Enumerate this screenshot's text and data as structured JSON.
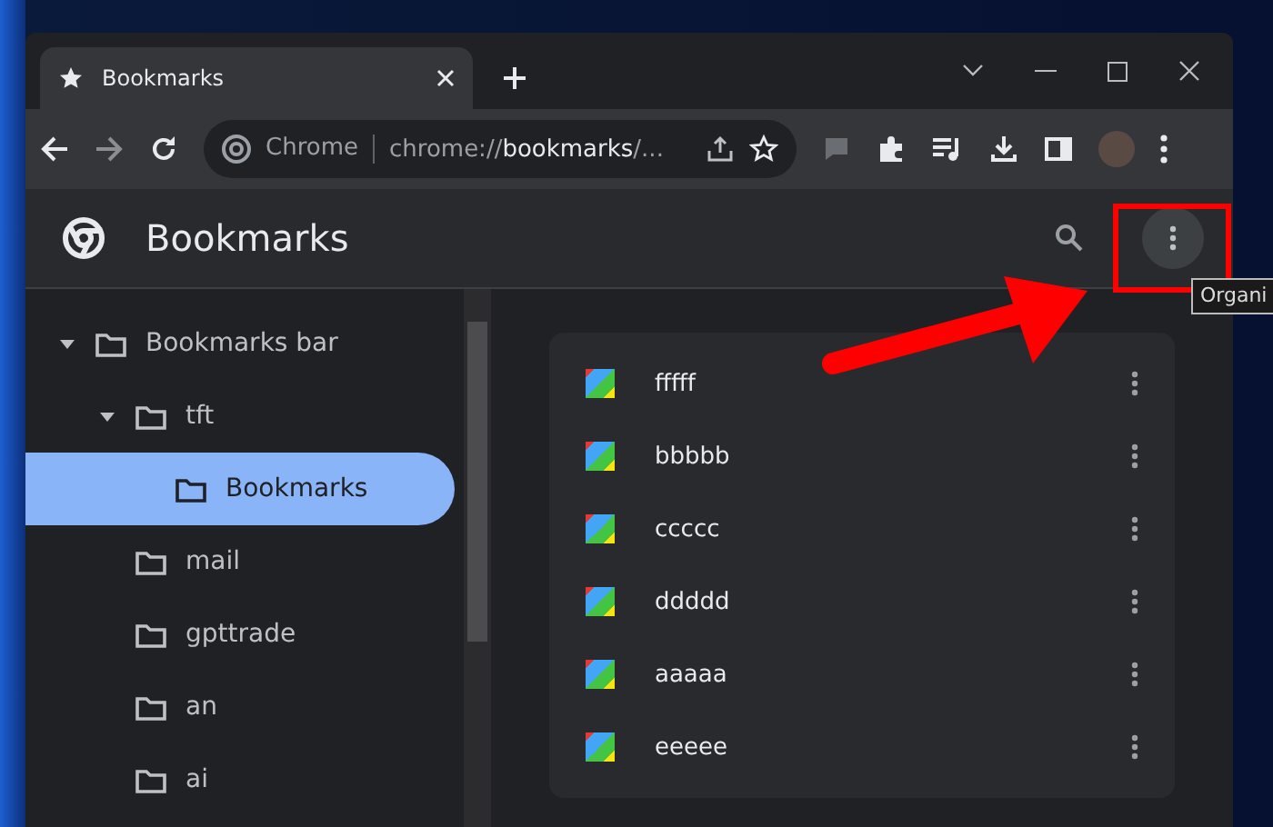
{
  "tab": {
    "title": "Bookmarks",
    "selected": true
  },
  "address_bar": {
    "site_label": "Chrome",
    "url": "chrome://**bookmarks**/..."
  },
  "page": {
    "title": "Bookmarks"
  },
  "tree": [
    {
      "label": "Bookmarks bar",
      "selected": false,
      "expanded": true,
      "children": [
        {
          "label": "tft",
          "selected": false,
          "expanded": true,
          "children": [
            {
              "label": "Bookmarks",
              "selected": true
            }
          ]
        },
        {
          "label": "mail",
          "selected": false
        },
        {
          "label": "gpttrade",
          "selected": false
        },
        {
          "label": "an",
          "selected": false
        },
        {
          "label": "ai",
          "selected": false
        }
      ]
    }
  ],
  "bookmarks": [
    {
      "title": "fffff"
    },
    {
      "title": "bbbbb"
    },
    {
      "title": "ccccc"
    },
    {
      "title": "ddddd"
    },
    {
      "title": "aaaaa"
    },
    {
      "title": "eeeee"
    }
  ],
  "tooltip": {
    "text": "Organi"
  }
}
